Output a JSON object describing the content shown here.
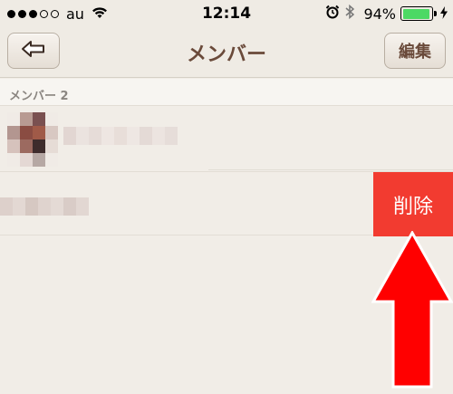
{
  "status_bar": {
    "carrier": "au",
    "time": "12:14",
    "battery_percent": "94%",
    "battery_level": 0.94
  },
  "nav": {
    "title": "メンバー",
    "edit_label": "編集"
  },
  "section": {
    "header": "メンバー 2"
  },
  "row_actions": {
    "delete_label": "削除"
  },
  "colors": {
    "background": "#f1ede7",
    "delete": "#f23b30",
    "arrow": "#ff0000",
    "title": "#6a4a3a"
  },
  "icons": [
    "back-arrow-icon",
    "wifi-icon",
    "alarm-icon",
    "bluetooth-icon",
    "battery-icon",
    "charging-icon"
  ]
}
